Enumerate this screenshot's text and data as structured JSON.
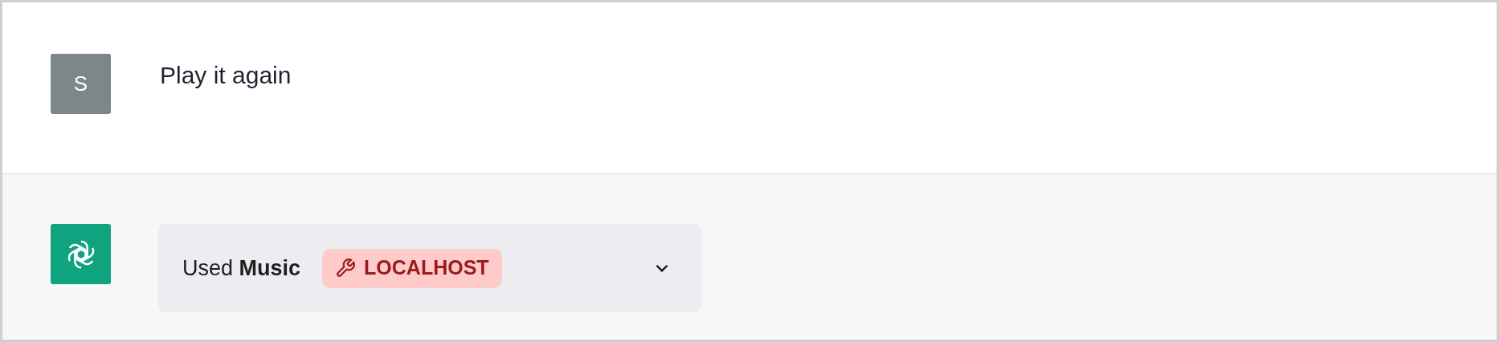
{
  "messages": [
    {
      "kind": "user",
      "avatar": "S",
      "text": "Play it again"
    },
    {
      "kind": "assistant",
      "tool": {
        "prefix": "Used",
        "name": "Music",
        "badge": "LOCALHOST",
        "expanded": false
      }
    }
  ]
}
